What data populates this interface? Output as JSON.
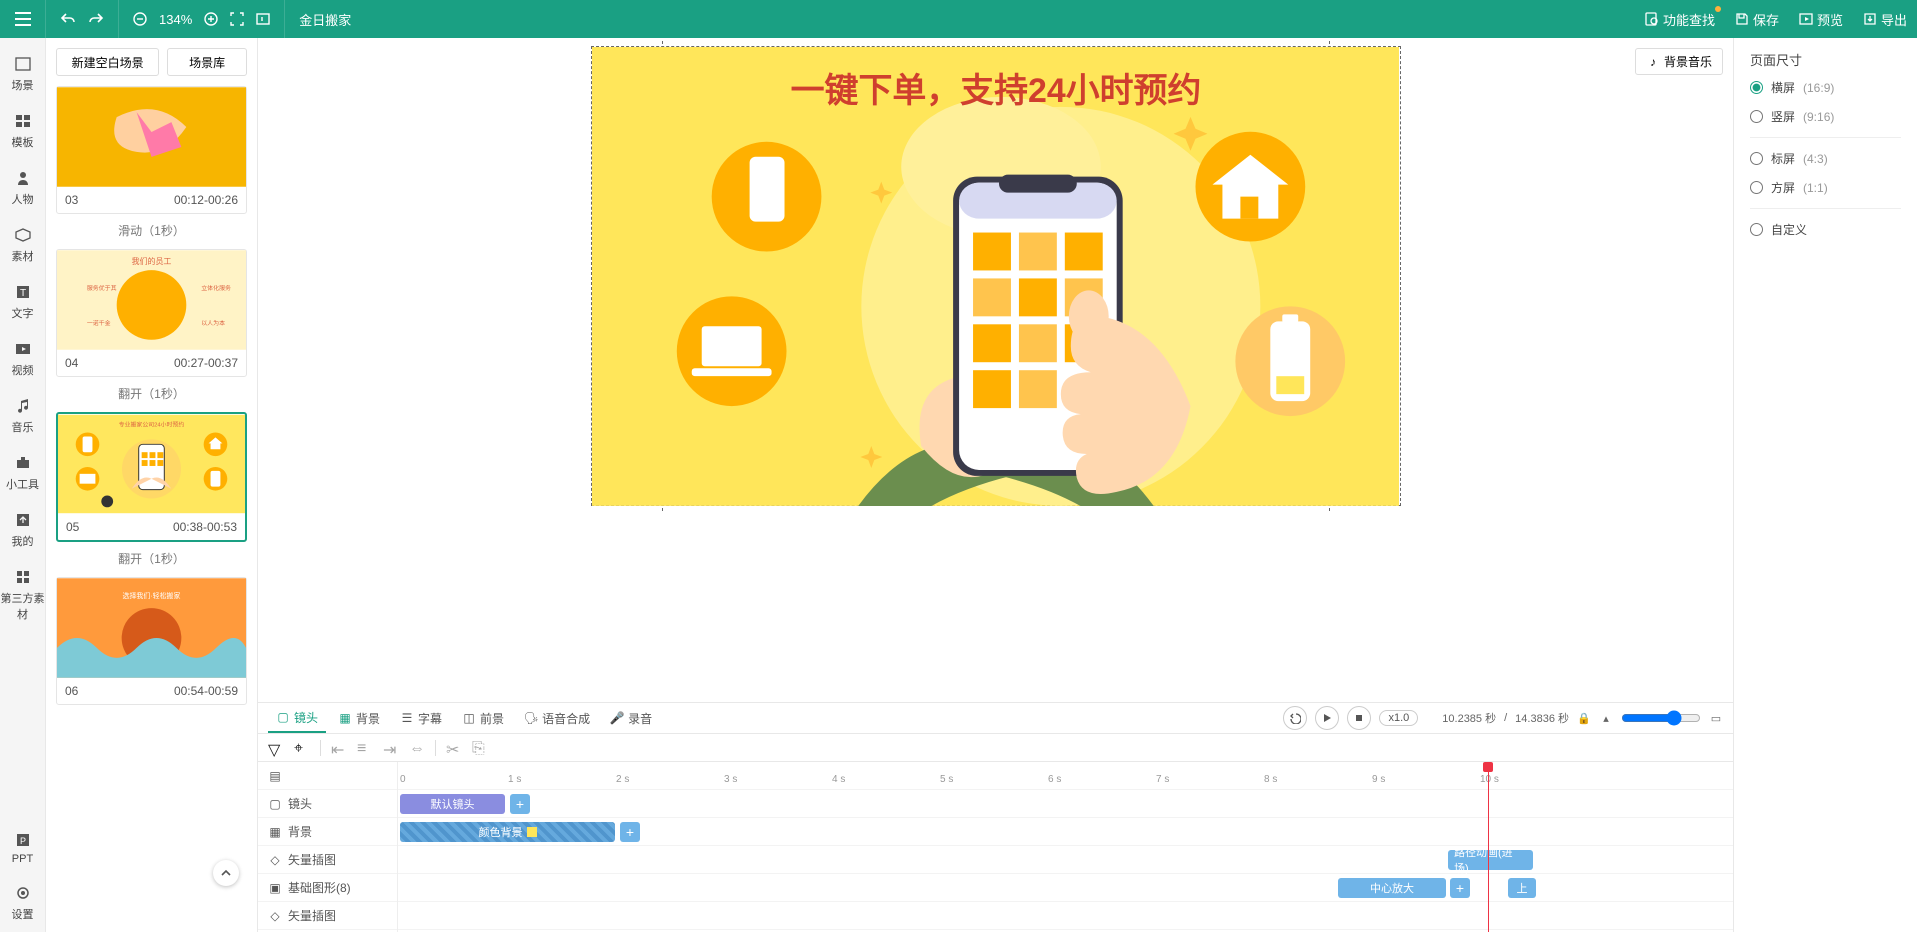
{
  "topbar": {
    "zoom": "134%",
    "title": "金日搬家",
    "feature_search": "功能查找",
    "save": "保存",
    "preview": "预览",
    "export": "导出"
  },
  "sidebar": {
    "items": [
      {
        "label": "场景"
      },
      {
        "label": "模板"
      },
      {
        "label": "人物"
      },
      {
        "label": "素材"
      },
      {
        "label": "文字"
      },
      {
        "label": "视频"
      },
      {
        "label": "音乐"
      },
      {
        "label": "小工具"
      },
      {
        "label": "我的"
      },
      {
        "label": "第三方素材"
      }
    ],
    "bottom": [
      {
        "label": "PPT"
      },
      {
        "label": "设置"
      }
    ]
  },
  "scene_panel": {
    "new_blank": "新建空白场景",
    "library": "场景库",
    "transitions": {
      "slide": "滑动（1秒）",
      "flip": "翻开（1秒）"
    },
    "scenes": [
      {
        "num": "03",
        "time": "00:12-00:26"
      },
      {
        "num": "04",
        "time": "00:27-00:37",
        "thumb_title": "我们的员工"
      },
      {
        "num": "05",
        "time": "00:38-00:53",
        "selected": true
      },
      {
        "num": "06",
        "time": "00:54-00:59"
      }
    ]
  },
  "canvas": {
    "default_camera": "默认镜头",
    "bg_music": "背景音乐",
    "headline": "一键下单，支持24小时预约"
  },
  "tabs": {
    "camera": "镜头",
    "background": "背景",
    "subtitle": "字幕",
    "foreground": "前景",
    "tts": "语音合成",
    "record": "录音",
    "speed": "x1.0",
    "time_current": "10.2385 秒",
    "time_total": "14.3836 秒"
  },
  "timeline": {
    "ticks": [
      "0",
      "1 s",
      "2 s",
      "3 s",
      "4 s",
      "5 s",
      "6 s",
      "7 s",
      "8 s",
      "9 s",
      "10 s"
    ],
    "rows": {
      "camera": "镜头",
      "background": "背景",
      "vector1": "矢量插图",
      "basic_shapes": "基础图形(8)",
      "vector2": "矢量插图"
    },
    "clips": {
      "default_camera": "默认镜头",
      "color_bg": "颜色背景",
      "path_anim": "路径动画(进场)",
      "center_zoom": "中心放大",
      "up": "上"
    }
  },
  "right_panel": {
    "title": "页面尺寸",
    "options": [
      {
        "label": "横屏",
        "hint": "(16:9)",
        "checked": true
      },
      {
        "label": "竖屏",
        "hint": "(9:16)"
      },
      {
        "label": "标屏",
        "hint": "(4:3)",
        "group2": true
      },
      {
        "label": "方屏",
        "hint": "(1:1)",
        "group2": true
      },
      {
        "label": "自定义",
        "group3": true
      }
    ]
  }
}
